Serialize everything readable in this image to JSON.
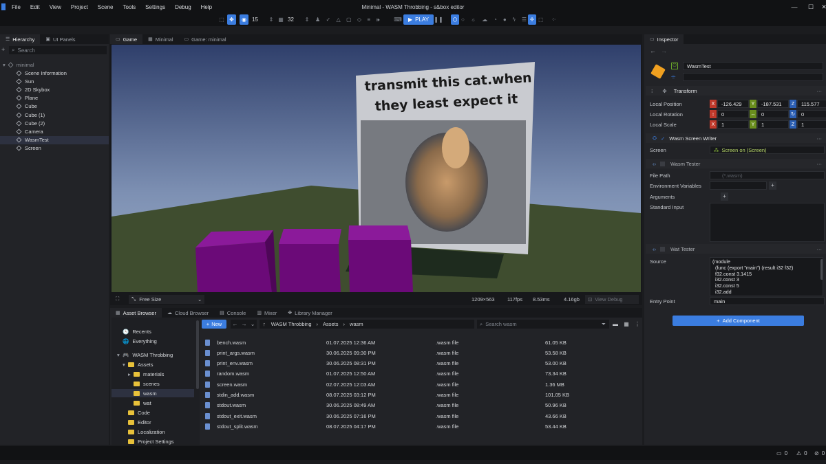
{
  "window": {
    "title": "Minimal - WASM Throbbing - s&box editor"
  },
  "menu": [
    "File",
    "Edit",
    "View",
    "Project",
    "Scene",
    "Tools",
    "Settings",
    "Debug",
    "Help"
  ],
  "toolbar": {
    "snap_value": "15",
    "grid_value": "32",
    "play_label": "PLAY"
  },
  "hierarchy": {
    "tabs": [
      "Hierarchy",
      "UI Panels"
    ],
    "search_placeholder": "Search",
    "root": "minimal",
    "items": [
      "Scene Information",
      "Sun",
      "2D Skybox",
      "Plane",
      "Cube",
      "Cube (1)",
      "Cube (2)",
      "Camera",
      "WasmTest",
      "Screen"
    ],
    "selected": "WasmTest"
  },
  "viewport": {
    "tabs": [
      "Game",
      "Minimal",
      "Game: minimal"
    ],
    "screen_text_line1": "transmit this cat.when",
    "screen_text_line2": "they least expect it",
    "size_mode": "Free Size",
    "resolution": "1209×563",
    "fps": "117fps",
    "frame_time": "8.53ms",
    "memory": "4.16gb",
    "view_debug": "View Debug"
  },
  "bottom_tabs": [
    "Asset Browser",
    "Cloud Browser",
    "Console",
    "Mixer",
    "Library Manager"
  ],
  "asset_browser": {
    "new_label": "New",
    "breadcrumb": [
      "WASM Throbbing",
      "Assets",
      "wasm"
    ],
    "search_placeholder": "Search wasm",
    "tree": [
      {
        "label": "Recents",
        "level": 0,
        "type": "recents"
      },
      {
        "label": "Everything",
        "level": 0,
        "type": "globe"
      },
      {
        "label": "WASM Throbbing",
        "level": 0,
        "type": "project"
      },
      {
        "label": "Assets",
        "level": 1,
        "type": "folder"
      },
      {
        "label": "materials",
        "level": 2,
        "type": "folder"
      },
      {
        "label": "scenes",
        "level": 2,
        "type": "folder"
      },
      {
        "label": "wasm",
        "level": 2,
        "type": "folder"
      },
      {
        "label": "wat",
        "level": 2,
        "type": "folder"
      },
      {
        "label": "Code",
        "level": 1,
        "type": "folder"
      },
      {
        "label": "Editor",
        "level": 1,
        "type": "folder"
      },
      {
        "label": "Localization",
        "level": 1,
        "type": "folder"
      },
      {
        "label": "Project Settings",
        "level": 1,
        "type": "folder"
      }
    ],
    "files": [
      {
        "name": "bench.wasm",
        "date": "01.07.2025 12:36 AM",
        "type": ".wasm file",
        "size": "61.05 KB"
      },
      {
        "name": "print_args.wasm",
        "date": "30.06.2025 09:30 PM",
        "type": ".wasm file",
        "size": "53.58 KB"
      },
      {
        "name": "print_env.wasm",
        "date": "30.06.2025 08:31 PM",
        "type": ".wasm file",
        "size": "53.00 KB"
      },
      {
        "name": "random.wasm",
        "date": "01.07.2025 12:50 AM",
        "type": ".wasm file",
        "size": "73.34 KB"
      },
      {
        "name": "screen.wasm",
        "date": "02.07.2025 12:03 AM",
        "type": ".wasm file",
        "size": "1.36 MB"
      },
      {
        "name": "stdin_add.wasm",
        "date": "08.07.2025 03:12 PM",
        "type": ".wasm file",
        "size": "101.05 KB"
      },
      {
        "name": "stdout.wasm",
        "date": "30.06.2025 08:49 AM",
        "type": ".wasm file",
        "size": "50.96 KB"
      },
      {
        "name": "stdout_exit.wasm",
        "date": "30.06.2025 07:16 PM",
        "type": ".wasm file",
        "size": "43.66 KB"
      },
      {
        "name": "stdout_split.wasm",
        "date": "08.07.2025 04:17 PM",
        "type": ".wasm file",
        "size": "53.44 KB"
      }
    ]
  },
  "inspector": {
    "tab": "Inspector",
    "object_name": "WasmTest",
    "transform": {
      "header": "Transform",
      "position_label": "Local Position",
      "rotation_label": "Local Rotation",
      "scale_label": "Local Scale",
      "position": [
        "-126.429",
        "-187.531",
        "115.577"
      ],
      "rotation": [
        "0",
        "0",
        "0"
      ],
      "scale": [
        "1",
        "1",
        "1"
      ]
    },
    "screen_writer": {
      "header": "Wasm Screen Writer",
      "screen_label": "Screen",
      "screen_value": "Screen on (Screen)"
    },
    "tester": {
      "header": "Wasm Tester",
      "file_path_label": "File Path",
      "file_path_placeholder": "(*.wasm)",
      "env_label": "Environment Variables",
      "args_label": "Arguments",
      "stdin_label": "Standard Input"
    },
    "wat_tester": {
      "header": "Wat Tester",
      "source_label": "Source",
      "source_lines": [
        "(module",
        "  (func (export \"main\") (result i32 f32)",
        "  f32.const 3.1415",
        "  i32.const 3",
        "  i32.const 5",
        "  i32.add"
      ],
      "entry_label": "Entry Point",
      "entry_value": "main"
    },
    "add_component": "Add Component"
  },
  "statusbar": {
    "count_a": "0",
    "count_b": "0",
    "count_c": "0"
  },
  "colors": {
    "accent": "#3b7de0",
    "folder": "#e8c13a",
    "cube": "#7a0f86",
    "x_axis": "#c0392b",
    "y_axis": "#6a8e1e",
    "z_axis": "#2c5fb3"
  }
}
